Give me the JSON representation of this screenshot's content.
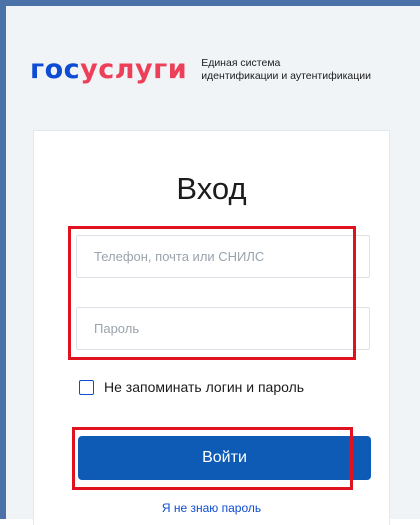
{
  "brand": {
    "logo_part1": "гос",
    "logo_part2": "услуги",
    "tagline_line1": "Единая система",
    "tagline_line2": "идентификации и аутентификации"
  },
  "login": {
    "title": "Вход",
    "username_placeholder": "Телефон, почта или СНИЛС",
    "username_value": "",
    "password_placeholder": "Пароль",
    "password_value": "",
    "remember_label": "Не запоминать логин и пароль",
    "remember_checked": false,
    "submit_label": "Войти",
    "forgot_link": "Я не знаю пароль"
  },
  "colors": {
    "brand_blue": "#0d4cd3",
    "brand_red": "#ee3f58",
    "button_blue": "#0d5bb5",
    "highlight_red": "#e0121f",
    "frame_blue": "#4a72a8"
  }
}
